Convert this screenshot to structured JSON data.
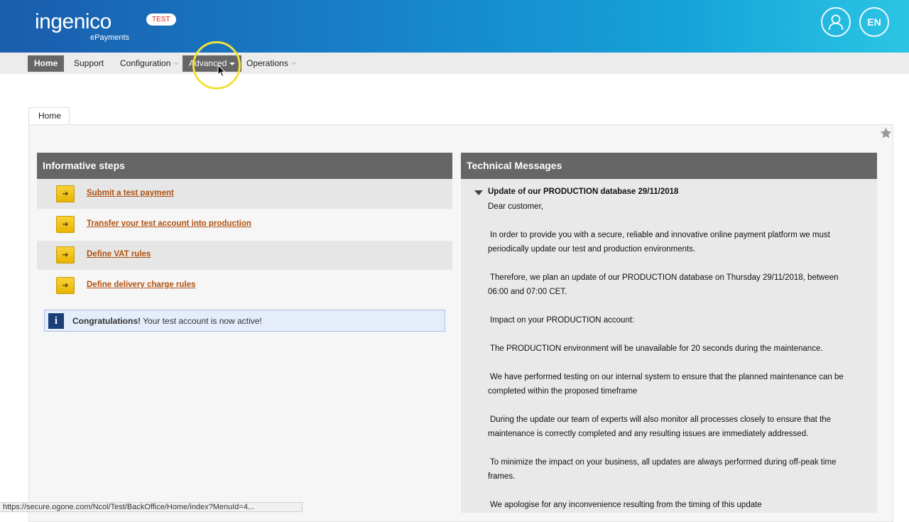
{
  "header": {
    "logo_main": "ingenico",
    "logo_sub": "ePayments",
    "env_badge": "TEST",
    "language": "EN"
  },
  "nav": {
    "items": [
      {
        "label": "Home",
        "active": true
      },
      {
        "label": "Support"
      },
      {
        "label": "Configuration",
        "dropdown": true
      },
      {
        "label": "Advanced",
        "dropdown": true,
        "open": true
      },
      {
        "label": "Operations",
        "dropdown": true
      }
    ]
  },
  "breadcrumb": {
    "tab": "Home"
  },
  "steps": {
    "title": "Informative steps",
    "items": [
      {
        "label": "Submit a test payment"
      },
      {
        "label": "Transfer your test account into production"
      },
      {
        "label": "Define VAT rules"
      },
      {
        "label": "Define delivery charge rules"
      }
    ],
    "notice_strong": "Congratulations!",
    "notice_text": " Your test account is now active!"
  },
  "tech": {
    "title": "Technical Messages",
    "message_title": "Update of our PRODUCTION database 29/11/2018",
    "lines": [
      "Dear customer,",
      "In order to provide you with a secure, reliable and innovative online payment platform we must periodically update our test and production environments.",
      "Therefore, we plan an update of our PRODUCTION database on Thursday 29/11/2018, between 06:00 and 07:00 CET.",
      "Impact on your PRODUCTION account:",
      "The PRODUCTION environment will be unavailable for 20 seconds during the maintenance.",
      "We have performed testing on our internal system to ensure that the planned maintenance can be completed within the proposed timeframe",
      "During the update our team of experts will also monitor all processes closely to ensure that the maintenance is correctly completed and any resulting issues are immediately addressed.",
      "To minimize the impact on your business, all updates are always performed during off-peak time frames.",
      "We apologise for any inconvenience resulting from the timing of this update"
    ]
  },
  "status_url": "https://secure.ogone.com/Ncol/Test/BackOffice/Home/index?MenuId=4..."
}
